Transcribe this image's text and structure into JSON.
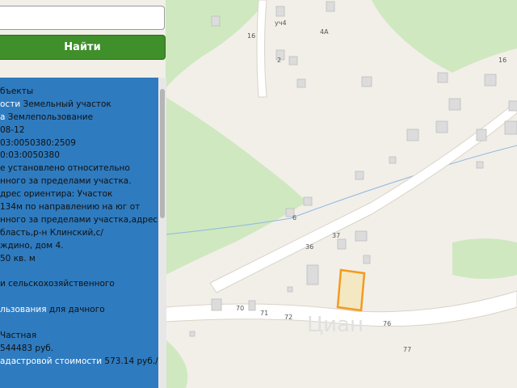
{
  "search": {
    "value": "",
    "placeholder": ""
  },
  "find_button": {
    "label": "Найти"
  },
  "info": {
    "l0": "бъекты",
    "l1k": "ости",
    "l1v": " Земельный участок",
    "l2k": "а",
    "l2v": " Землепользование",
    "l3v": "08-12",
    "l4v": "03:0050380:2509",
    "l5v": "0:03:0050380",
    "l6v": "е установлено относительно",
    "l7v": "нного за пределами участка.",
    "l8v": "дрес ориентира: Участок",
    "l9v": "134м по направлению на юг от",
    "l10v": "нного за пределами участка,адрес",
    "l11v": "бласть,р-н Клинский,с/",
    "l12v": "ждино, дом 4.",
    "l13v": "50 кв. м",
    "l14v": "",
    "l15v": "и сельскохозяйственного",
    "l16v": "",
    "l17k": "льзования",
    "l17v": " для дачного",
    "l18v": "",
    "l19v": "Частная",
    "l20v": " 544483 руб.",
    "l21k": "адастровой стоимости",
    "l21v": " 573.14 руб./"
  },
  "map": {
    "labels": [
      "16",
      "уч4",
      "4А",
      "2",
      "16",
      "6",
      "37",
      "36",
      "70",
      "71",
      "72",
      "76",
      "77"
    ]
  }
}
